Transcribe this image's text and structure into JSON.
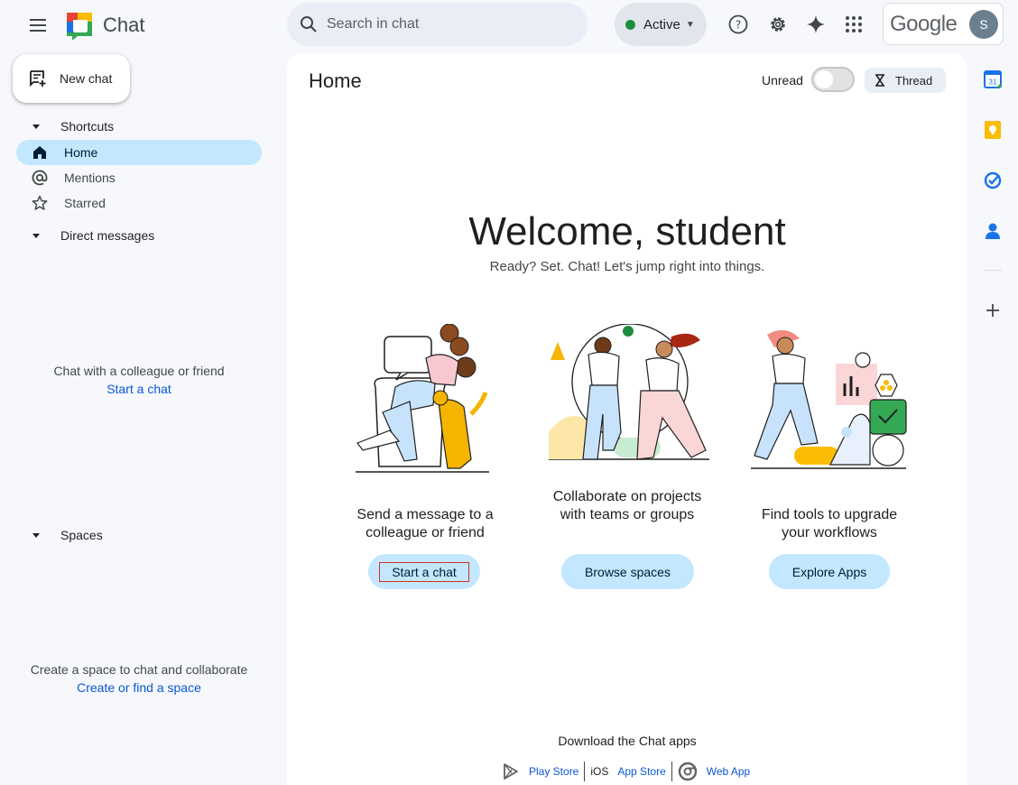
{
  "app": {
    "title": "Chat"
  },
  "search": {
    "placeholder": "Search in chat"
  },
  "status": {
    "label": "Active",
    "color": "#1e8e3e"
  },
  "account": {
    "brand": "Google",
    "avatar_letter": "S"
  },
  "sidebar": {
    "new_chat_label": "New chat",
    "shortcuts_label": "Shortcuts",
    "items": [
      {
        "label": "Home",
        "icon": "home-icon",
        "active": true
      },
      {
        "label": "Mentions",
        "icon": "at-icon",
        "active": false
      },
      {
        "label": "Starred",
        "icon": "star-icon",
        "active": false
      }
    ],
    "dm_label": "Direct messages",
    "dm_empty_text": "Chat with a colleague or friend",
    "dm_empty_link": "Start a chat",
    "spaces_label": "Spaces",
    "spaces_empty_text": "Create a space to chat and collaborate",
    "spaces_empty_link": "Create or find a space"
  },
  "main": {
    "title": "Home",
    "unread_label": "Unread",
    "thread_label": "Thread",
    "welcome": "Welcome, student",
    "subtitle": "Ready? Set. Chat! Let's jump right into things.",
    "cards": [
      {
        "text": "Send a message to a colleague or friend",
        "button": "Start a chat"
      },
      {
        "text": "Collaborate on projects with teams or groups",
        "button": "Browse spaces"
      },
      {
        "text": "Find tools to upgrade your workflows",
        "button": "Explore Apps"
      }
    ],
    "download_label": "Download the Chat apps",
    "stores": [
      {
        "label": "Play Store",
        "icon": "play-store-icon"
      },
      {
        "label": "App Store",
        "icon": "ios-icon",
        "glyph": "iOS"
      },
      {
        "label": "Web App",
        "icon": "chrome-icon"
      }
    ]
  },
  "rail": [
    "calendar-icon",
    "keep-icon",
    "tasks-icon",
    "contacts-icon",
    "add-icon"
  ],
  "colors": {
    "accent": "#0b57d0",
    "active_bg": "#c2e7ff",
    "background": "#f6f8fc"
  }
}
